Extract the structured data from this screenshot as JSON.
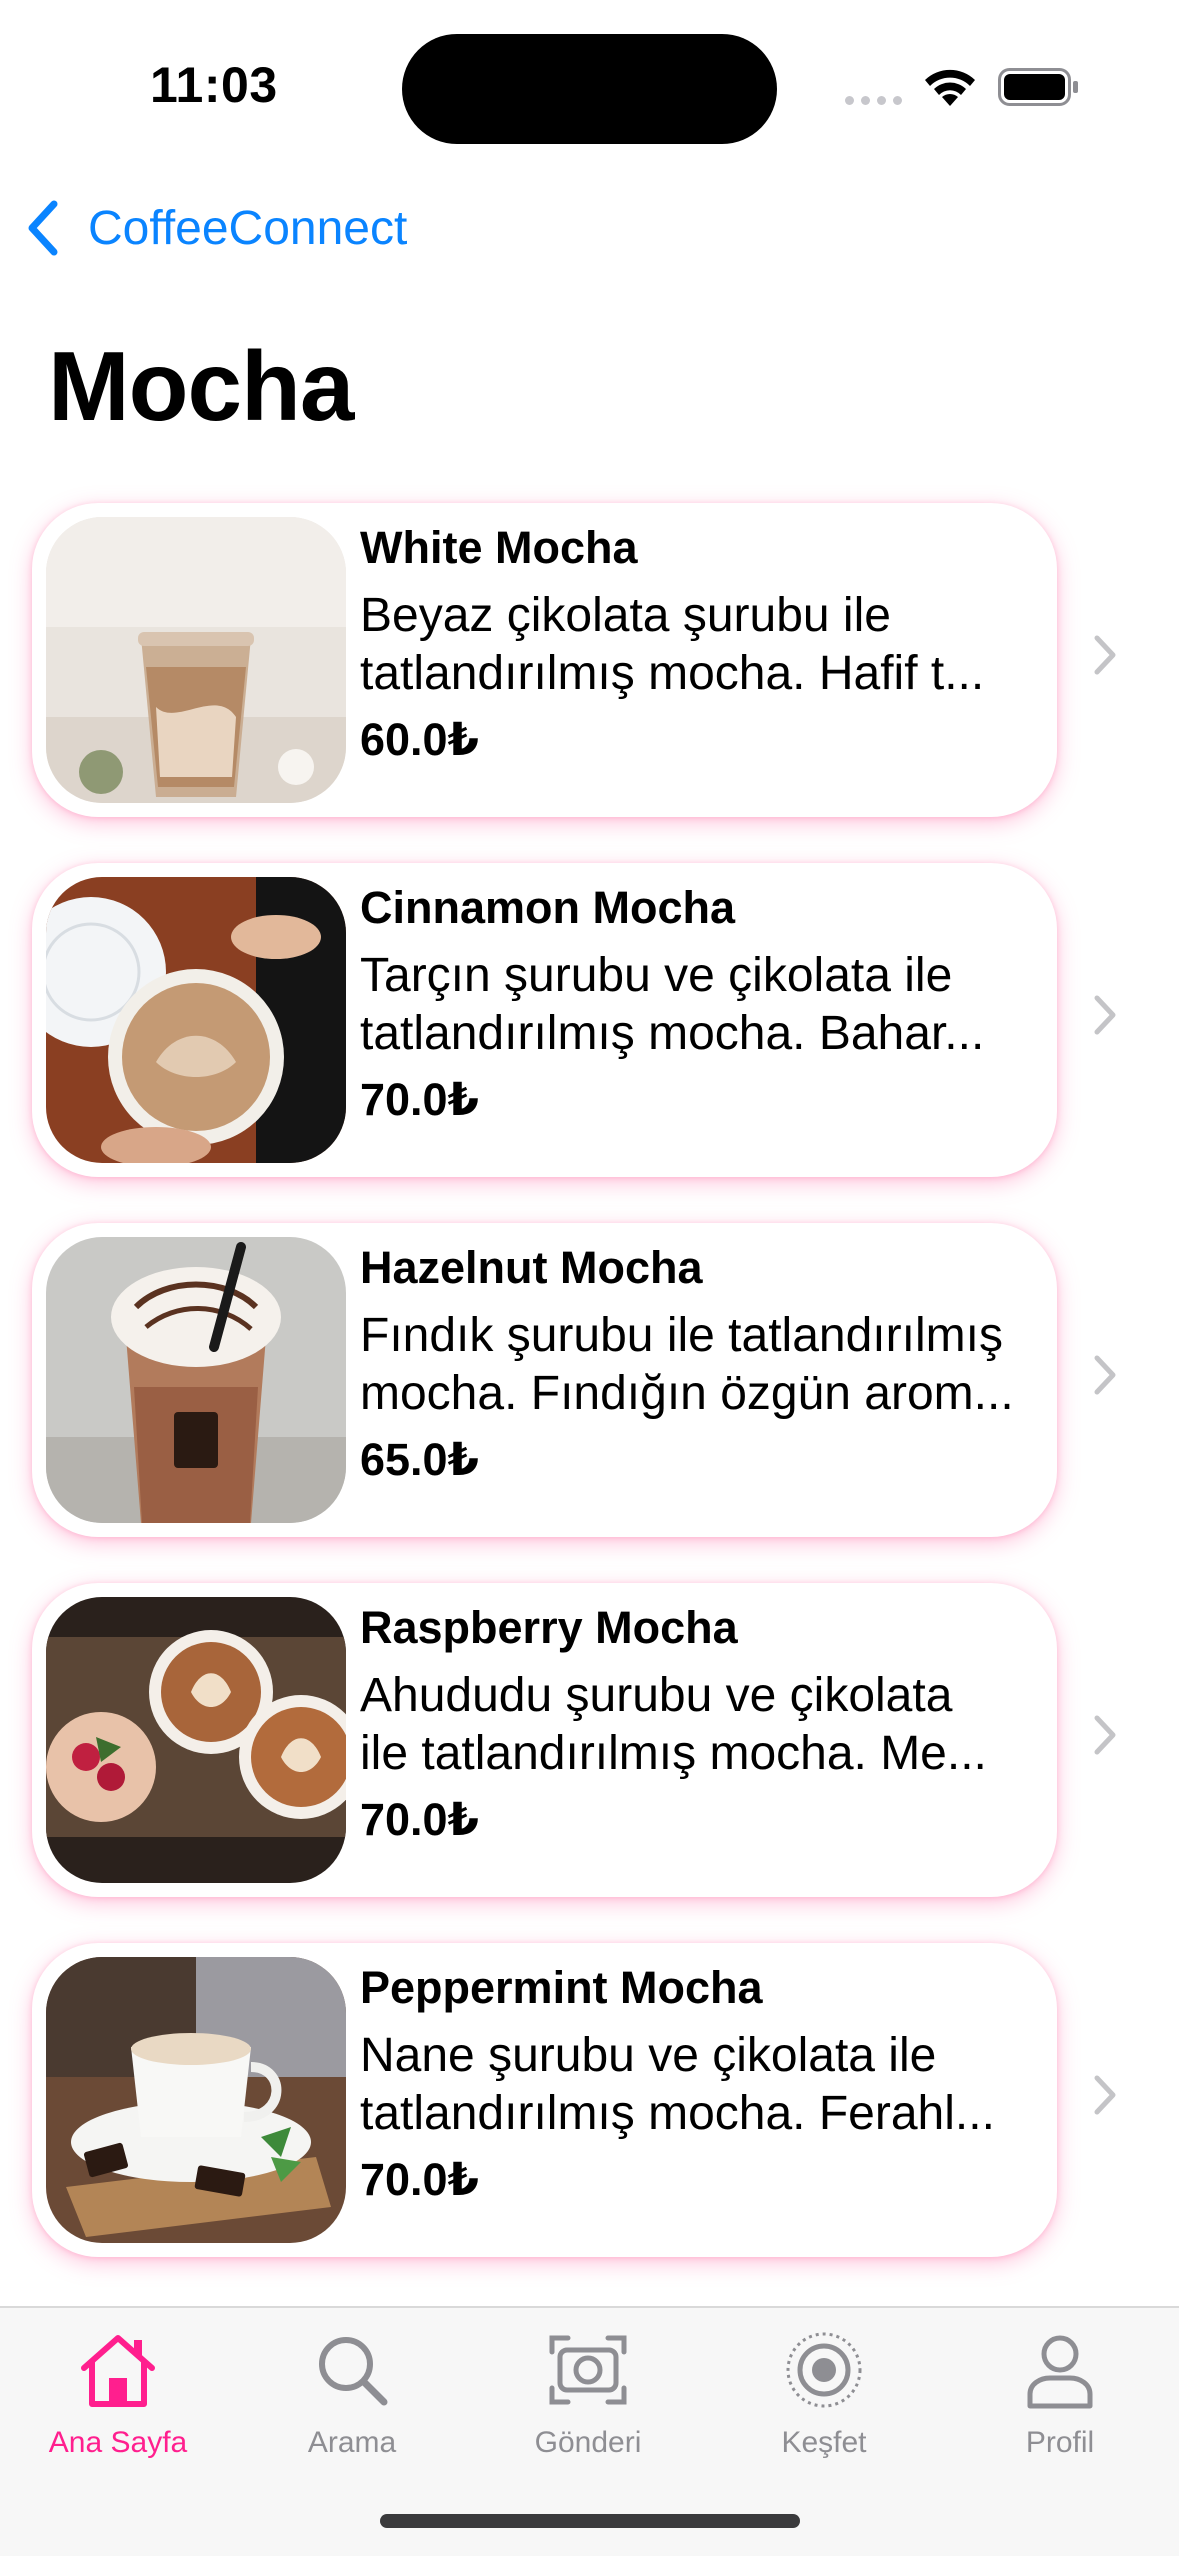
{
  "status_bar": {
    "time": "11:03"
  },
  "nav": {
    "back_label": "CoffeeConnect",
    "title": "Mocha"
  },
  "items": [
    {
      "name": "White Mocha",
      "desc_line1": "Beyaz çikolata şurubu ile",
      "desc_line2": "tatlandırılmış mocha. Hafif t...",
      "price": "60.0₺"
    },
    {
      "name": "Cinnamon Mocha",
      "desc_line1": "Tarçın şurubu ve çikolata ile",
      "desc_line2": "tatlandırılmış mocha. Bahar...",
      "price": "70.0₺"
    },
    {
      "name": "Hazelnut Mocha",
      "desc_line1": "Fındık şurubu ile tatlandırılmış",
      "desc_line2": "mocha. Fındığın özgün arom...",
      "price": "65.0₺"
    },
    {
      "name": "Raspberry Mocha",
      "desc_line1": "Ahududu şurubu ve çikolata",
      "desc_line2": "ile tatlandırılmış mocha. Me...",
      "price": "70.0₺"
    },
    {
      "name": "Peppermint Mocha",
      "desc_line1": "Nane şurubu ve çikolata ile",
      "desc_line2": "tatlandırılmış mocha. Ferahl...",
      "price": "70.0₺"
    }
  ],
  "tabs": [
    {
      "label": "Ana Sayfa",
      "icon": "home-icon",
      "active": true
    },
    {
      "label": "Arama",
      "icon": "search-icon",
      "active": false
    },
    {
      "label": "Gönderi",
      "icon": "camera-viewfinder-icon",
      "active": false
    },
    {
      "label": "Keşfet",
      "icon": "explore-icon",
      "active": false
    },
    {
      "label": "Profil",
      "icon": "person-icon",
      "active": false
    }
  ],
  "colors": {
    "accent": "#0a84ff",
    "active_tab": "#ff1f8e",
    "inactive_tab": "#8e8e93",
    "card_glow": "#ff5fa0"
  }
}
